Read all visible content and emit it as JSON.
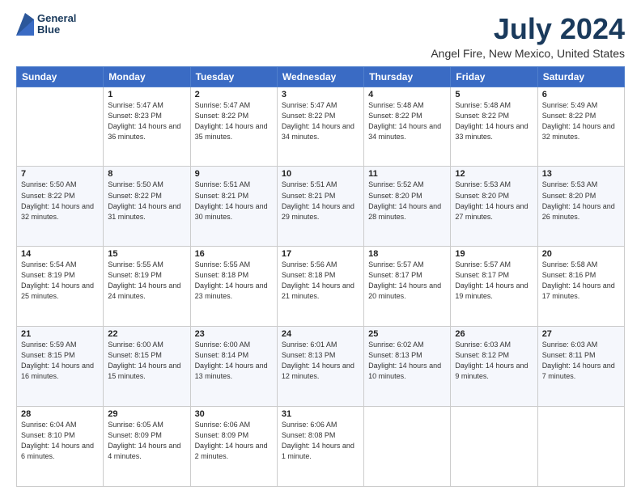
{
  "header": {
    "logo_line1": "General",
    "logo_line2": "Blue",
    "title": "July 2024",
    "subtitle": "Angel Fire, New Mexico, United States"
  },
  "days_of_week": [
    "Sunday",
    "Monday",
    "Tuesday",
    "Wednesday",
    "Thursday",
    "Friday",
    "Saturday"
  ],
  "weeks": [
    [
      {
        "day": "",
        "sunrise": "",
        "sunset": "",
        "daylight": ""
      },
      {
        "day": "1",
        "sunrise": "Sunrise: 5:47 AM",
        "sunset": "Sunset: 8:23 PM",
        "daylight": "Daylight: 14 hours and 36 minutes."
      },
      {
        "day": "2",
        "sunrise": "Sunrise: 5:47 AM",
        "sunset": "Sunset: 8:22 PM",
        "daylight": "Daylight: 14 hours and 35 minutes."
      },
      {
        "day": "3",
        "sunrise": "Sunrise: 5:47 AM",
        "sunset": "Sunset: 8:22 PM",
        "daylight": "Daylight: 14 hours and 34 minutes."
      },
      {
        "day": "4",
        "sunrise": "Sunrise: 5:48 AM",
        "sunset": "Sunset: 8:22 PM",
        "daylight": "Daylight: 14 hours and 34 minutes."
      },
      {
        "day": "5",
        "sunrise": "Sunrise: 5:48 AM",
        "sunset": "Sunset: 8:22 PM",
        "daylight": "Daylight: 14 hours and 33 minutes."
      },
      {
        "day": "6",
        "sunrise": "Sunrise: 5:49 AM",
        "sunset": "Sunset: 8:22 PM",
        "daylight": "Daylight: 14 hours and 32 minutes."
      }
    ],
    [
      {
        "day": "7",
        "sunrise": "Sunrise: 5:50 AM",
        "sunset": "Sunset: 8:22 PM",
        "daylight": "Daylight: 14 hours and 32 minutes."
      },
      {
        "day": "8",
        "sunrise": "Sunrise: 5:50 AM",
        "sunset": "Sunset: 8:22 PM",
        "daylight": "Daylight: 14 hours and 31 minutes."
      },
      {
        "day": "9",
        "sunrise": "Sunrise: 5:51 AM",
        "sunset": "Sunset: 8:21 PM",
        "daylight": "Daylight: 14 hours and 30 minutes."
      },
      {
        "day": "10",
        "sunrise": "Sunrise: 5:51 AM",
        "sunset": "Sunset: 8:21 PM",
        "daylight": "Daylight: 14 hours and 29 minutes."
      },
      {
        "day": "11",
        "sunrise": "Sunrise: 5:52 AM",
        "sunset": "Sunset: 8:20 PM",
        "daylight": "Daylight: 14 hours and 28 minutes."
      },
      {
        "day": "12",
        "sunrise": "Sunrise: 5:53 AM",
        "sunset": "Sunset: 8:20 PM",
        "daylight": "Daylight: 14 hours and 27 minutes."
      },
      {
        "day": "13",
        "sunrise": "Sunrise: 5:53 AM",
        "sunset": "Sunset: 8:20 PM",
        "daylight": "Daylight: 14 hours and 26 minutes."
      }
    ],
    [
      {
        "day": "14",
        "sunrise": "Sunrise: 5:54 AM",
        "sunset": "Sunset: 8:19 PM",
        "daylight": "Daylight: 14 hours and 25 minutes."
      },
      {
        "day": "15",
        "sunrise": "Sunrise: 5:55 AM",
        "sunset": "Sunset: 8:19 PM",
        "daylight": "Daylight: 14 hours and 24 minutes."
      },
      {
        "day": "16",
        "sunrise": "Sunrise: 5:55 AM",
        "sunset": "Sunset: 8:18 PM",
        "daylight": "Daylight: 14 hours and 23 minutes."
      },
      {
        "day": "17",
        "sunrise": "Sunrise: 5:56 AM",
        "sunset": "Sunset: 8:18 PM",
        "daylight": "Daylight: 14 hours and 21 minutes."
      },
      {
        "day": "18",
        "sunrise": "Sunrise: 5:57 AM",
        "sunset": "Sunset: 8:17 PM",
        "daylight": "Daylight: 14 hours and 20 minutes."
      },
      {
        "day": "19",
        "sunrise": "Sunrise: 5:57 AM",
        "sunset": "Sunset: 8:17 PM",
        "daylight": "Daylight: 14 hours and 19 minutes."
      },
      {
        "day": "20",
        "sunrise": "Sunrise: 5:58 AM",
        "sunset": "Sunset: 8:16 PM",
        "daylight": "Daylight: 14 hours and 17 minutes."
      }
    ],
    [
      {
        "day": "21",
        "sunrise": "Sunrise: 5:59 AM",
        "sunset": "Sunset: 8:15 PM",
        "daylight": "Daylight: 14 hours and 16 minutes."
      },
      {
        "day": "22",
        "sunrise": "Sunrise: 6:00 AM",
        "sunset": "Sunset: 8:15 PM",
        "daylight": "Daylight: 14 hours and 15 minutes."
      },
      {
        "day": "23",
        "sunrise": "Sunrise: 6:00 AM",
        "sunset": "Sunset: 8:14 PM",
        "daylight": "Daylight: 14 hours and 13 minutes."
      },
      {
        "day": "24",
        "sunrise": "Sunrise: 6:01 AM",
        "sunset": "Sunset: 8:13 PM",
        "daylight": "Daylight: 14 hours and 12 minutes."
      },
      {
        "day": "25",
        "sunrise": "Sunrise: 6:02 AM",
        "sunset": "Sunset: 8:13 PM",
        "daylight": "Daylight: 14 hours and 10 minutes."
      },
      {
        "day": "26",
        "sunrise": "Sunrise: 6:03 AM",
        "sunset": "Sunset: 8:12 PM",
        "daylight": "Daylight: 14 hours and 9 minutes."
      },
      {
        "day": "27",
        "sunrise": "Sunrise: 6:03 AM",
        "sunset": "Sunset: 8:11 PM",
        "daylight": "Daylight: 14 hours and 7 minutes."
      }
    ],
    [
      {
        "day": "28",
        "sunrise": "Sunrise: 6:04 AM",
        "sunset": "Sunset: 8:10 PM",
        "daylight": "Daylight: 14 hours and 6 minutes."
      },
      {
        "day": "29",
        "sunrise": "Sunrise: 6:05 AM",
        "sunset": "Sunset: 8:09 PM",
        "daylight": "Daylight: 14 hours and 4 minutes."
      },
      {
        "day": "30",
        "sunrise": "Sunrise: 6:06 AM",
        "sunset": "Sunset: 8:09 PM",
        "daylight": "Daylight: 14 hours and 2 minutes."
      },
      {
        "day": "31",
        "sunrise": "Sunrise: 6:06 AM",
        "sunset": "Sunset: 8:08 PM",
        "daylight": "Daylight: 14 hours and 1 minute."
      },
      {
        "day": "",
        "sunrise": "",
        "sunset": "",
        "daylight": ""
      },
      {
        "day": "",
        "sunrise": "",
        "sunset": "",
        "daylight": ""
      },
      {
        "day": "",
        "sunrise": "",
        "sunset": "",
        "daylight": ""
      }
    ]
  ]
}
